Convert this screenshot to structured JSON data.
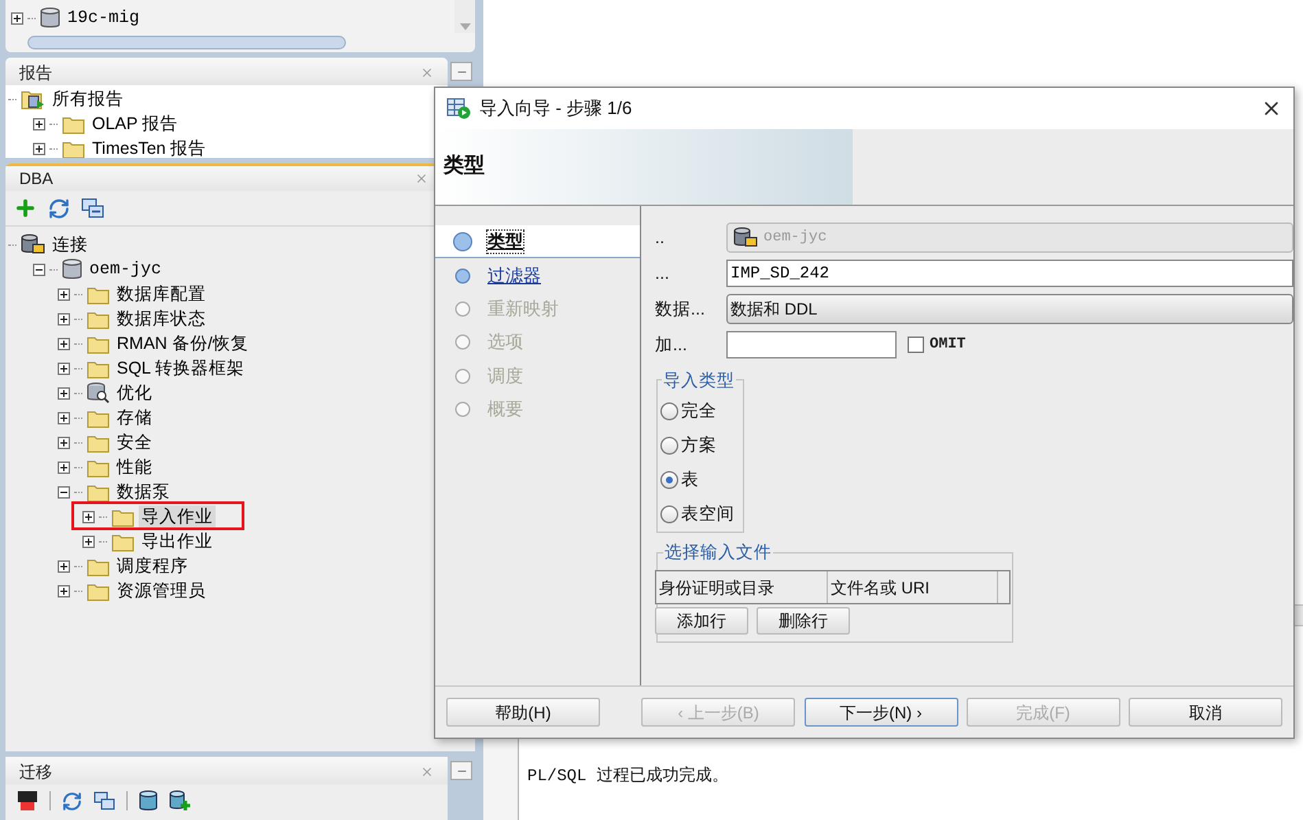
{
  "connections_panel": {
    "items": [
      {
        "label": "19c-mig",
        "kind": "database",
        "expanded": false,
        "selected": false
      }
    ]
  },
  "reports_panel": {
    "title": "报告",
    "items": [
      {
        "label": "所有报告",
        "kind": "reports",
        "selected": false,
        "children": [
          {
            "label": "OLAP 报告",
            "kind": "folder",
            "expanded": false,
            "selected": false
          },
          {
            "label": "TimesTen 报告",
            "kind": "folder",
            "expanded": false,
            "selected": false
          }
        ]
      }
    ]
  },
  "dba_panel": {
    "title": "DBA",
    "active": true,
    "items": [
      {
        "label": "连接",
        "kind": "connection",
        "selected": false,
        "children": [
          {
            "label": "oem-jyc",
            "kind": "database",
            "expanded": true,
            "selected": false,
            "children": [
              {
                "label": "数据库配置",
                "kind": "folder",
                "expanded": false,
                "selected": false
              },
              {
                "label": "数据库状态",
                "kind": "folder",
                "expanded": false,
                "selected": false
              },
              {
                "label": "RMAN 备份/恢复",
                "kind": "folder",
                "expanded": false,
                "selected": false
              },
              {
                "label": "SQL 转换器框架",
                "kind": "folder",
                "expanded": false,
                "selected": false
              },
              {
                "label": "优化",
                "kind": "tuning",
                "expanded": false,
                "selected": false
              },
              {
                "label": "存储",
                "kind": "folder",
                "expanded": false,
                "selected": false
              },
              {
                "label": "安全",
                "kind": "folder",
                "expanded": false,
                "selected": false
              },
              {
                "label": "性能",
                "kind": "folder",
                "expanded": false,
                "selected": false
              },
              {
                "label": "数据泵",
                "kind": "folder",
                "expanded": true,
                "selected": false,
                "children": [
                  {
                    "label": "导入作业",
                    "kind": "folder",
                    "expanded": false,
                    "selected": true,
                    "annotated": true
                  },
                  {
                    "label": "导出作业",
                    "kind": "folder",
                    "expanded": false,
                    "selected": false
                  }
                ]
              },
              {
                "label": "调度程序",
                "kind": "folder",
                "expanded": false,
                "selected": false
              },
              {
                "label": "资源管理员",
                "kind": "folder",
                "expanded": false,
                "selected": false
              }
            ]
          }
        ]
      }
    ]
  },
  "migration_panel": {
    "title": "迁移"
  },
  "output": {
    "text": "PL/SQL 过程已成功完成。"
  },
  "dialog": {
    "title": "导入向导 - 步骤 1/6",
    "header": "类型",
    "steps": [
      {
        "label": "类型",
        "selected": true,
        "disabled": false
      },
      {
        "label": "过滤器",
        "selected": false,
        "disabled": false
      },
      {
        "label": "重新映射",
        "selected": false,
        "disabled": true
      },
      {
        "label": "选项",
        "selected": false,
        "disabled": true
      },
      {
        "label": "调度",
        "selected": false,
        "disabled": true
      },
      {
        "label": "概要",
        "selected": false,
        "disabled": true
      }
    ],
    "fields": [
      {
        "label": "..",
        "kind": "connection",
        "value": "oem-jyc",
        "disabled": true
      },
      {
        "label": "...",
        "kind": "text",
        "value": "IMP_SD_242",
        "disabled": false
      },
      {
        "label": "数据...",
        "kind": "select",
        "value": "数据和 DDL",
        "disabled": false
      },
      {
        "label": "加...",
        "kind": "short",
        "disabled": false,
        "checkbox": {
          "label": "OMIT",
          "checked": false
        }
      }
    ],
    "import_type": {
      "title": "导入类型",
      "options": [
        {
          "label": "完全",
          "selected": false
        },
        {
          "label": "方案",
          "selected": false
        },
        {
          "label": "表",
          "selected": true
        },
        {
          "label": "表空间",
          "selected": false
        }
      ]
    },
    "input_files": {
      "title": "选择输入文件",
      "columns": [
        "身份证明或目录",
        "文件名或 URI"
      ],
      "buttons": [
        "添加行",
        "删除行"
      ]
    },
    "buttons": [
      {
        "label": "帮助(H)",
        "disabled": false,
        "default": false
      },
      {
        "label": "‹ 上一步(B)",
        "disabled": true,
        "default": false
      },
      {
        "label": "下一步(N) ›",
        "disabled": false,
        "default": true
      },
      {
        "label": "完成(F)",
        "disabled": true,
        "default": false
      },
      {
        "label": "取消",
        "disabled": false,
        "default": false
      }
    ]
  }
}
